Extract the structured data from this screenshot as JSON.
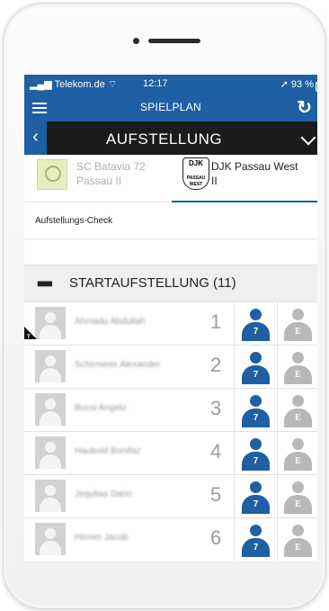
{
  "status": {
    "carrier": "Telekom.de",
    "time": "12:17",
    "battery": "93 %"
  },
  "nav": {
    "title": "SPIELPLAN"
  },
  "subnav": {
    "title": "AUFSTELLUNG"
  },
  "teams": {
    "home": {
      "name_line1": "SC Batavia 72",
      "name_line2": "Passau II"
    },
    "away": {
      "name_line1": "DJK Passau West",
      "name_line2": "II",
      "logo_text_top": "DJK",
      "logo_text_bottom": "PASSAU WEST"
    },
    "selected": "away"
  },
  "check": {
    "label": "Aufstellungs-Check"
  },
  "section": {
    "title": "STARTAUFSTELLUNG (11)"
  },
  "starter_badge": "7",
  "ersatz_badge": "E",
  "captain_marker": "T",
  "players": [
    {
      "name": "Ahmadu Abdullah",
      "number": "1"
    },
    {
      "name": "Schirmeier Alexander",
      "number": "2"
    },
    {
      "name": "Bucsi Angelo",
      "number": "3"
    },
    {
      "name": "Haubold Bonifaz",
      "number": "4"
    },
    {
      "name": "Jequitas Dario",
      "number": "5"
    },
    {
      "name": "Hirmer Jacob",
      "number": "6"
    }
  ],
  "colors": {
    "primary": "#1f5fa3",
    "dark_bar": "#1b1b1b",
    "ersatz_gray": "#b8b8b8"
  }
}
